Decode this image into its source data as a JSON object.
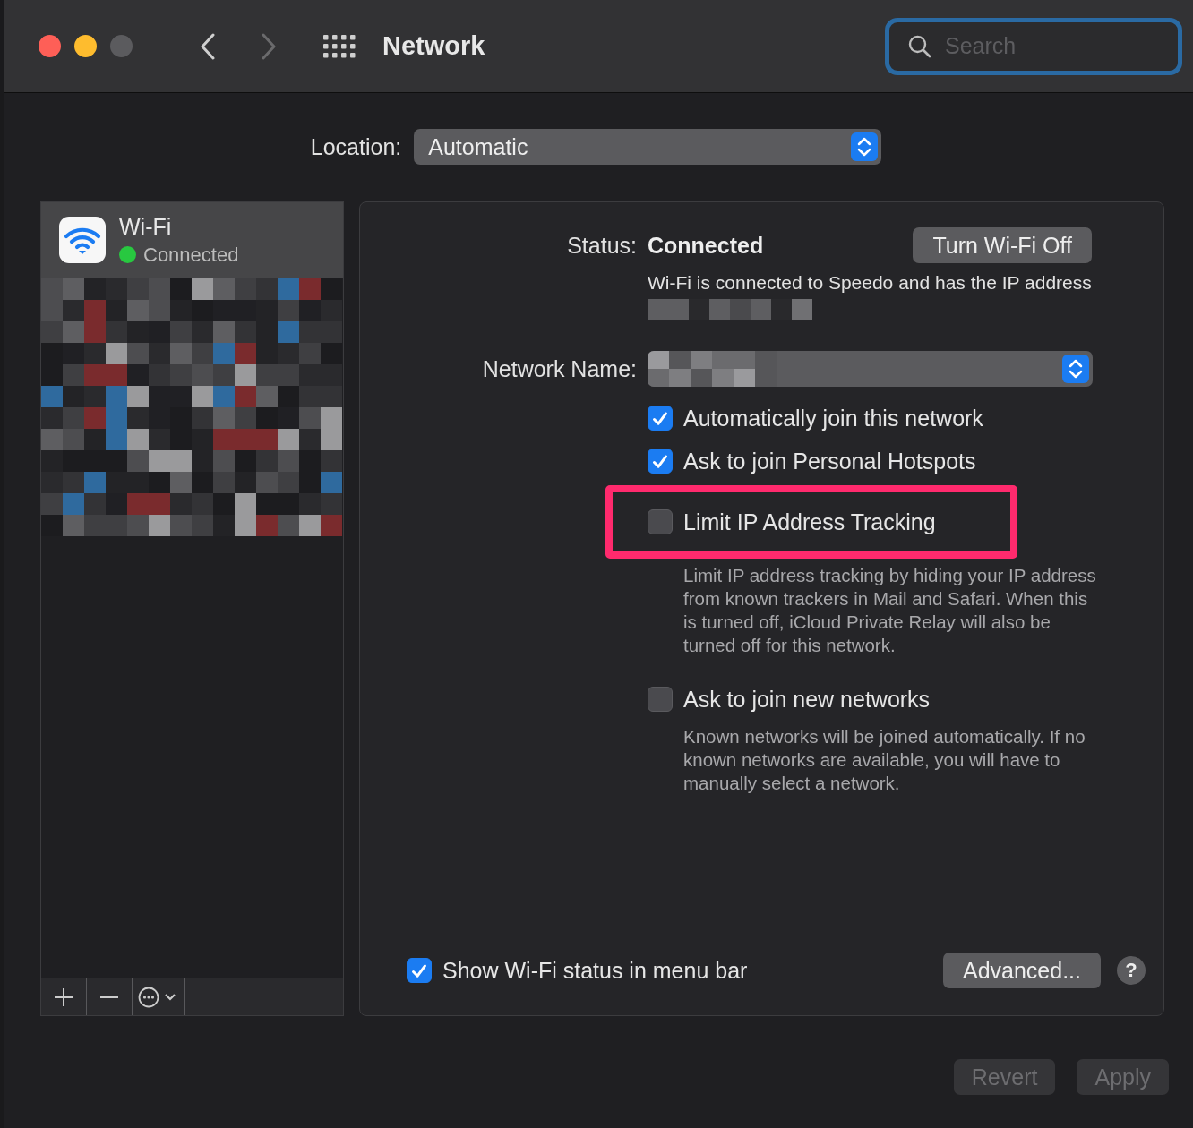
{
  "window": {
    "title": "Network"
  },
  "search": {
    "placeholder": "Search",
    "focused": true
  },
  "location": {
    "label": "Location:",
    "value": "Automatic"
  },
  "sidebar": {
    "services": [
      {
        "name": "Wi-Fi",
        "status": "Connected",
        "color": "#28c840",
        "selected": true
      }
    ]
  },
  "status": {
    "label": "Status:",
    "value": "Connected",
    "button": "Turn Wi-Fi Off",
    "description": "Wi-Fi is connected to Speedo and has the IP address"
  },
  "network_name": {
    "label": "Network Name:"
  },
  "options": [
    {
      "label": "Automatically join this network",
      "checked": true
    },
    {
      "label": "Ask to join Personal Hotspots",
      "checked": true
    },
    {
      "label": "Limit IP Address Tracking",
      "checked": false,
      "highlighted": true,
      "description": "Limit IP address tracking by hiding your IP address from known trackers in Mail and Safari. When this is turned off, iCloud Private Relay will also be turned off for this network."
    },
    {
      "label": "Ask to join new networks",
      "checked": false,
      "description": "Known networks will be joined automatically. If no known networks are available, you will have to manually select a network."
    }
  ],
  "show_status": {
    "label": "Show Wi-Fi status in menu bar",
    "checked": true
  },
  "advanced_button": "Advanced...",
  "help_button": "?",
  "footer_buttons": [
    {
      "label": "Revert",
      "disabled": true
    },
    {
      "label": "Apply",
      "disabled": true
    }
  ]
}
